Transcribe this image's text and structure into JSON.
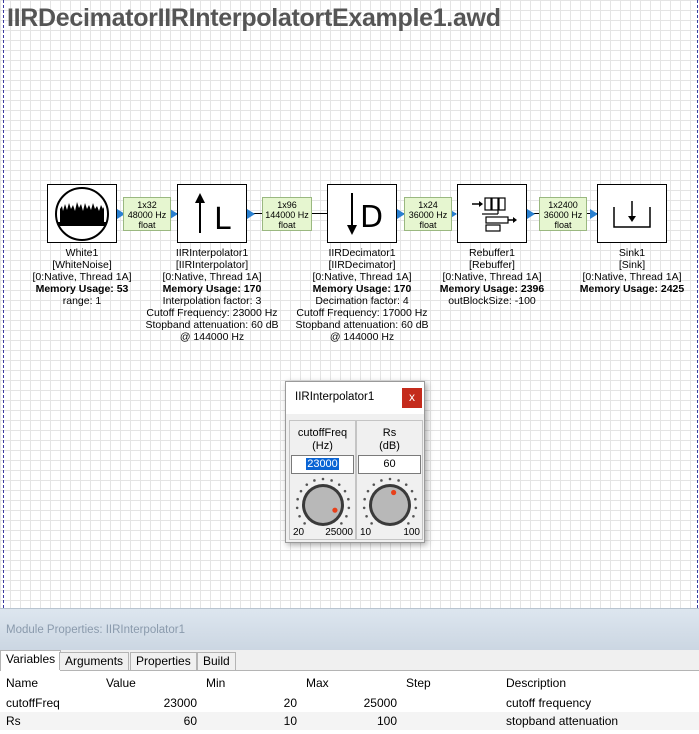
{
  "canvas": {
    "title": "IIRDecimatorIIRInterpolatortExample1.awd"
  },
  "blocks": [
    {
      "id": "white1",
      "name": "White1",
      "type": "[WhiteNoise]",
      "thread": "[0:Native, Thread 1A]",
      "memory": "Memory Usage: 53",
      "extra": [
        "range: 1"
      ]
    },
    {
      "id": "interp1",
      "name": "IIRInterpolator1",
      "type": "[IIRInterpolator]",
      "thread": "[0:Native, Thread 1A]",
      "memory": "Memory Usage: 170",
      "extra": [
        "Interpolation factor: 3",
        "Cutoff Frequency: 23000 Hz",
        "Stopband attenuation: 60 dB",
        "@ 144000 Hz"
      ],
      "glyph": "L"
    },
    {
      "id": "decim1",
      "name": "IIRDecimator1",
      "type": "[IIRDecimator]",
      "thread": "[0:Native, Thread 1A]",
      "memory": "Memory Usage: 170",
      "extra": [
        "Decimation factor: 4",
        "Cutoff Frequency: 17000 Hz",
        "Stopband attenuation: 60 dB",
        "@ 144000 Hz"
      ],
      "glyph": "D"
    },
    {
      "id": "rebuf1",
      "name": "Rebuffer1",
      "type": "[Rebuffer]",
      "thread": "[0:Native, Thread 1A]",
      "memory": "Memory Usage: 2396",
      "extra": [
        "outBlockSize: -100"
      ]
    },
    {
      "id": "sink1",
      "name": "Sink1",
      "type": "[Sink]",
      "thread": "[0:Native, Thread 1A]",
      "memory": "Memory Usage: 2425",
      "extra": []
    }
  ],
  "wires": [
    {
      "dims": "1x32",
      "rate": "48000 Hz",
      "dtype": "float"
    },
    {
      "dims": "1x96",
      "rate": "144000 Hz",
      "dtype": "float"
    },
    {
      "dims": "1x24",
      "rate": "36000 Hz",
      "dtype": "float"
    },
    {
      "dims": "1x2400",
      "rate": "36000 Hz",
      "dtype": "float"
    }
  ],
  "dialog": {
    "title": "IIRInterpolator1",
    "close": "x",
    "controls": [
      {
        "label": "cutoffFreq",
        "unit": "(Hz)",
        "value": "23000",
        "min": "20",
        "max": "25000",
        "level": 0.92
      },
      {
        "label": "Rs",
        "unit": "(dB)",
        "value": "60",
        "min": "10",
        "max": "100",
        "level": 0.56
      }
    ]
  },
  "props": {
    "header": "Module Properties: IIRInterpolator1",
    "tabs": [
      "Variables",
      "Arguments",
      "Properties",
      "Build"
    ],
    "columns": [
      "Name",
      "Value",
      "Min",
      "Max",
      "Step",
      "Description"
    ],
    "rows": [
      {
        "name": "cutoffFreq",
        "value": "23000",
        "min": "20",
        "max": "25000",
        "step": "",
        "desc": "cutoff frequency"
      },
      {
        "name": "Rs",
        "value": "60",
        "min": "10",
        "max": "100",
        "step": "",
        "desc": "stopband attenuation"
      }
    ]
  },
  "colors": {
    "pin": "#2a80d0",
    "badge": "#e6f6d0",
    "close": "#c42b1c",
    "knob_dot": "#e8401a"
  }
}
